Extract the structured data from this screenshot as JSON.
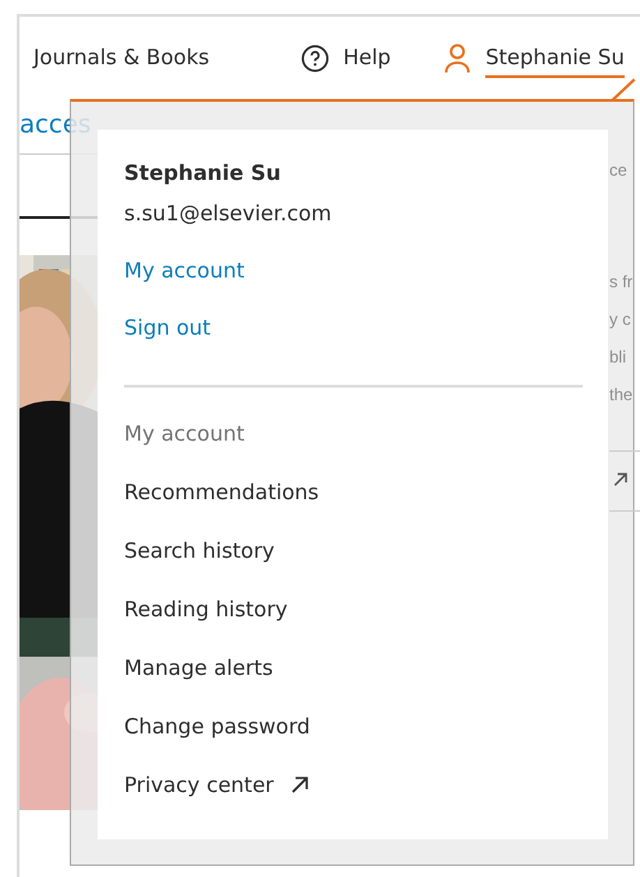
{
  "header": {
    "nav": [
      {
        "label": "Journals & Books",
        "kind": "text",
        "selected": false
      },
      {
        "label": "Help",
        "kind": "help",
        "selected": false
      },
      {
        "label": "Stephanie Su",
        "kind": "user",
        "selected": true
      }
    ]
  },
  "background": {
    "link_fragment": "acces",
    "top_fragment": "ce",
    "fragments": [
      "s fr",
      "y c",
      "bli",
      "the"
    ]
  },
  "menu": {
    "name": "Stephanie Su",
    "email": "s.su1@elsevier.com",
    "links": [
      "My account",
      "Sign out"
    ],
    "section_title": "My account",
    "items": [
      {
        "label": "Recommendations",
        "external": false
      },
      {
        "label": "Search history",
        "external": false
      },
      {
        "label": "Reading history",
        "external": false
      },
      {
        "label": "Manage alerts",
        "external": false
      },
      {
        "label": "Change password",
        "external": false
      },
      {
        "label": "Privacy center",
        "external": true
      }
    ]
  }
}
